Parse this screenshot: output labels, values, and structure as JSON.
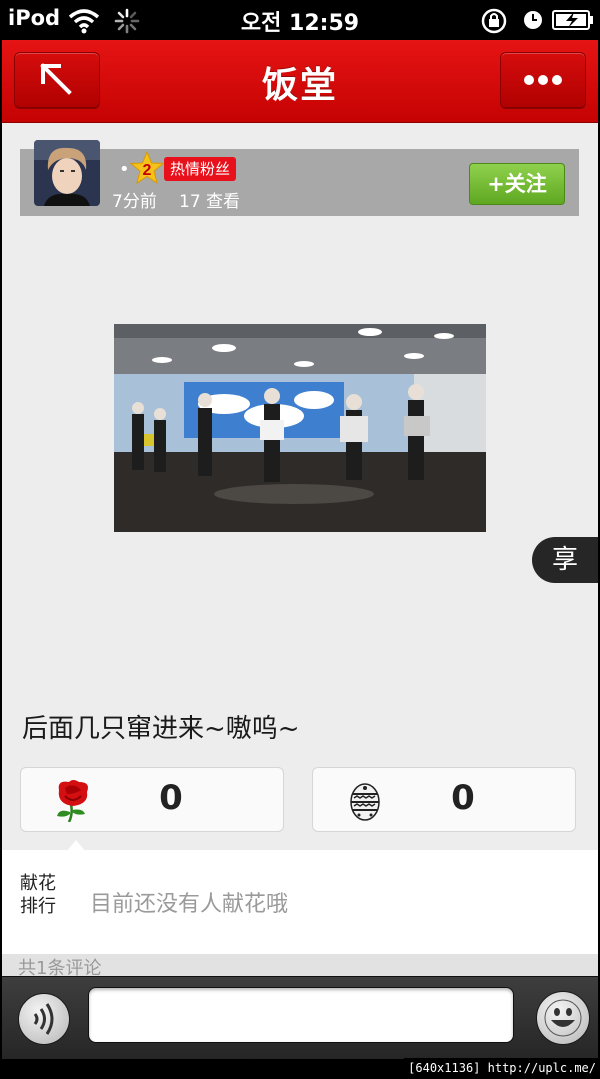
{
  "status_bar": {
    "carrier": "iPod",
    "time": "오전 12:59",
    "icons": [
      "wifi-icon",
      "activity-spinner-icon",
      "rotation-lock-icon",
      "alarm-icon",
      "battery-icon"
    ]
  },
  "nav": {
    "title": "饭堂",
    "back_icon": "arrow-up-left-icon",
    "more_icon": "more-icon"
  },
  "post": {
    "level": "2",
    "fan_badge": "热情粉丝",
    "separator": "•",
    "time_ago": "7分前",
    "views": "17 查看",
    "follow_label": "+关注",
    "share_label": "享",
    "text": "后面几只窜进来~嗷呜~"
  },
  "stats": {
    "flower_count": "0",
    "egg_count": "0"
  },
  "ranking": {
    "label": "献花排行",
    "empty_text": "目前还没有人献花哦"
  },
  "comments": {
    "header": "共1条评论"
  },
  "input_bar": {
    "placeholder": "",
    "voice_icon": "voice-icon",
    "emoji_icon": "emoji-icon"
  },
  "watermark": "[640x1136] http://uplc.me/",
  "colors": {
    "nav_red": "#d00808",
    "follow_green": "#6cbf2a",
    "badge_red": "#e8101a"
  }
}
